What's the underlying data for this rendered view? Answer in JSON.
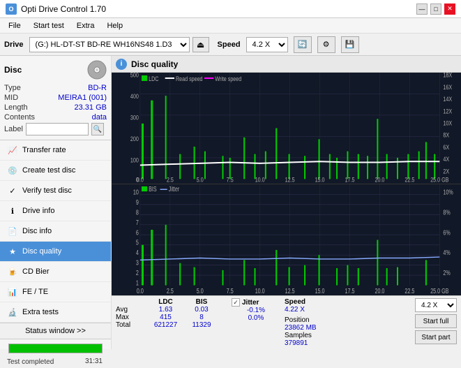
{
  "app": {
    "title": "Opti Drive Control 1.70",
    "icon": "O"
  },
  "titlebar": {
    "minimize": "—",
    "maximize": "□",
    "close": "✕"
  },
  "menu": {
    "items": [
      "File",
      "Start test",
      "Extra",
      "Help"
    ]
  },
  "toolbar": {
    "drive_label": "Drive",
    "drive_value": "(G:)  HL-DT-ST BD-RE  WH16NS48 1.D3",
    "speed_label": "Speed",
    "speed_value": "4.2 X"
  },
  "disc": {
    "title": "Disc",
    "type_label": "Type",
    "type_value": "BD-R",
    "mid_label": "MID",
    "mid_value": "MEIRA1 (001)",
    "length_label": "Length",
    "length_value": "23.31 GB",
    "contents_label": "Contents",
    "contents_value": "data",
    "label_label": "Label",
    "label_value": ""
  },
  "nav": {
    "items": [
      {
        "id": "transfer-rate",
        "label": "Transfer rate",
        "icon": "📈"
      },
      {
        "id": "create-test-disc",
        "label": "Create test disc",
        "icon": "💿"
      },
      {
        "id": "verify-test-disc",
        "label": "Verify test disc",
        "icon": "✓"
      },
      {
        "id": "drive-info",
        "label": "Drive info",
        "icon": "ℹ"
      },
      {
        "id": "disc-info",
        "label": "Disc info",
        "icon": "📄"
      },
      {
        "id": "disc-quality",
        "label": "Disc quality",
        "icon": "★",
        "active": true
      },
      {
        "id": "cd-bier",
        "label": "CD Bier",
        "icon": "🍺"
      },
      {
        "id": "fe-te",
        "label": "FE / TE",
        "icon": "📊"
      },
      {
        "id": "extra-tests",
        "label": "Extra tests",
        "icon": "🔬"
      }
    ]
  },
  "status": {
    "window_btn": "Status window >>",
    "progress": 100,
    "status_text": "Test completed",
    "time": "31:31"
  },
  "disc_quality": {
    "title": "Disc quality",
    "legend": {
      "ldc": "LDC",
      "read_speed": "Read speed",
      "write_speed": "Write speed",
      "bis": "BIS",
      "jitter": "Jitter"
    },
    "upper_chart": {
      "y_max": 500,
      "y_marks_left": [
        "500",
        "400",
        "300",
        "200",
        "100",
        "0"
      ],
      "y_marks_right": [
        "18X",
        "16X",
        "14X",
        "12X",
        "10X",
        "8X",
        "6X",
        "4X",
        "2X"
      ],
      "x_marks": [
        "0.0",
        "2.5",
        "5.0",
        "7.5",
        "10.0",
        "12.5",
        "15.0",
        "17.5",
        "20.0",
        "22.5",
        "25.0 GB"
      ]
    },
    "lower_chart": {
      "y_marks_left": [
        "10",
        "9",
        "8",
        "7",
        "6",
        "5",
        "4",
        "3",
        "2",
        "1"
      ],
      "y_marks_right": [
        "10%",
        "8%",
        "6%",
        "4%",
        "2%"
      ],
      "x_marks": [
        "0.0",
        "2.5",
        "5.0",
        "7.5",
        "10.0",
        "12.5",
        "15.0",
        "17.5",
        "20.0",
        "22.5",
        "25.0 GB"
      ]
    }
  },
  "stats": {
    "columns": [
      "",
      "LDC",
      "BIS",
      "",
      "Jitter",
      "Speed",
      ""
    ],
    "rows": {
      "avg": {
        "label": "Avg",
        "ldc": "1.63",
        "bis": "0.03",
        "jitter": "-0.1%",
        "speed_val": "4.22 X"
      },
      "max": {
        "label": "Max",
        "ldc": "415",
        "bis": "8",
        "jitter": "0.0%"
      },
      "total": {
        "label": "Total",
        "ldc": "621227",
        "bis": "11329"
      }
    },
    "position_label": "Position",
    "position_value": "23862 MB",
    "samples_label": "Samples",
    "samples_value": "379891",
    "speed_select": "4.2 X",
    "start_full": "Start full",
    "start_part": "Start part",
    "jitter_checked": true,
    "jitter_label": "Jitter"
  }
}
